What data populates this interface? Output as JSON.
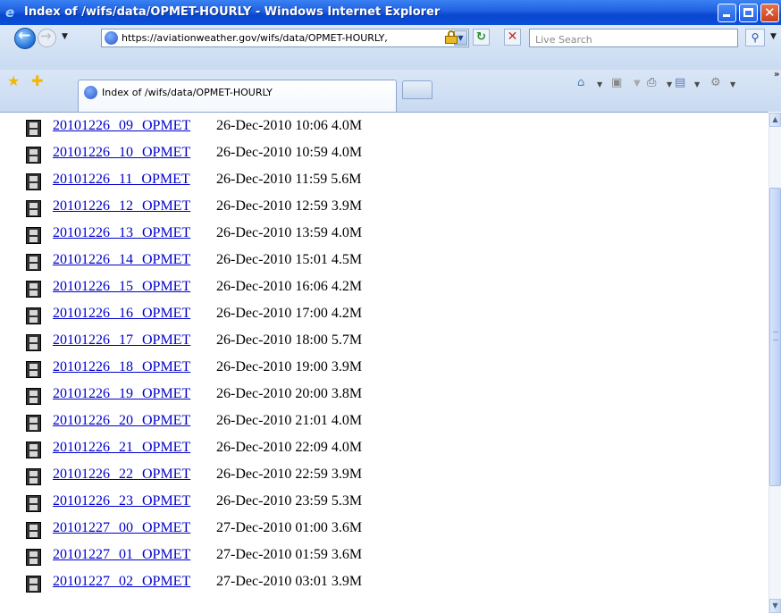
{
  "window": {
    "title": "Index of /wifs/data/OPMET-HOURLY - Windows Internet Explorer"
  },
  "address_bar": {
    "url": "https://aviationweather.gov/wifs/data/OPMET-HOURLY,"
  },
  "search": {
    "placeholder": "Live Search"
  },
  "tabs": [
    {
      "label": "Index of /wifs/data/OPMET-HOURLY"
    }
  ],
  "files": [
    {
      "name": "20101226 09 OPMET",
      "date": "26-Dec-2010 10:06",
      "size": "4.0M"
    },
    {
      "name": "20101226 10 OPMET",
      "date": "26-Dec-2010 10:59",
      "size": "4.0M"
    },
    {
      "name": "20101226 11 OPMET",
      "date": "26-Dec-2010 11:59",
      "size": "5.6M"
    },
    {
      "name": "20101226 12 OPMET",
      "date": "26-Dec-2010 12:59",
      "size": "3.9M"
    },
    {
      "name": "20101226 13 OPMET",
      "date": "26-Dec-2010 13:59",
      "size": "4.0M"
    },
    {
      "name": "20101226 14 OPMET",
      "date": "26-Dec-2010 15:01",
      "size": "4.5M"
    },
    {
      "name": "20101226 15 OPMET",
      "date": "26-Dec-2010 16:06",
      "size": "4.2M"
    },
    {
      "name": "20101226 16 OPMET",
      "date": "26-Dec-2010 17:00",
      "size": "4.2M"
    },
    {
      "name": "20101226 17 OPMET",
      "date": "26-Dec-2010 18:00",
      "size": "5.7M"
    },
    {
      "name": "20101226 18 OPMET",
      "date": "26-Dec-2010 19:00",
      "size": "3.9M"
    },
    {
      "name": "20101226 19 OPMET",
      "date": "26-Dec-2010 20:00",
      "size": "3.8M"
    },
    {
      "name": "20101226 20 OPMET",
      "date": "26-Dec-2010 21:01",
      "size": "4.0M"
    },
    {
      "name": "20101226 21 OPMET",
      "date": "26-Dec-2010 22:09",
      "size": "4.0M"
    },
    {
      "name": "20101226 22 OPMET",
      "date": "26-Dec-2010 22:59",
      "size": "3.9M"
    },
    {
      "name": "20101226 23 OPMET",
      "date": "26-Dec-2010 23:59",
      "size": "5.3M"
    },
    {
      "name": "20101227 00 OPMET",
      "date": "27-Dec-2010 01:00",
      "size": "3.6M"
    },
    {
      "name": "20101227 01 OPMET",
      "date": "27-Dec-2010 01:59",
      "size": "3.6M"
    },
    {
      "name": "20101227 02 OPMET",
      "date": "27-Dec-2010 03:01",
      "size": "3.9M"
    }
  ]
}
